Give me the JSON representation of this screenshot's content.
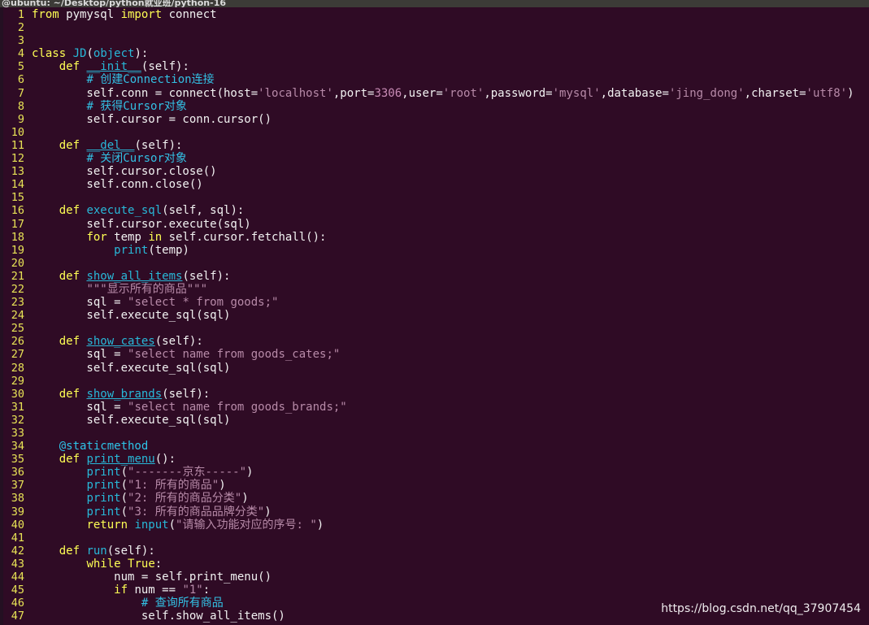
{
  "window": {
    "title": "@ubuntu: ~/Desktop/python就业班/python-16"
  },
  "editor": {
    "lines": [
      [
        [
          "k",
          "from"
        ],
        [
          "t",
          " pymysql "
        ],
        [
          "k",
          "import"
        ],
        [
          "t",
          " connect"
        ]
      ],
      [],
      [],
      [
        [
          "k",
          "class"
        ],
        [
          "t",
          " "
        ],
        [
          "b",
          "JD"
        ],
        [
          "t",
          "("
        ],
        [
          "b",
          "object"
        ],
        [
          "t",
          "):"
        ]
      ],
      [
        [
          "t",
          "    "
        ],
        [
          "k",
          "def"
        ],
        [
          "t",
          " "
        ],
        [
          "bu",
          "__init__"
        ],
        [
          "t",
          "(self):"
        ]
      ],
      [
        [
          "t",
          "        "
        ],
        [
          "c",
          "# 创建Connection连接"
        ]
      ],
      [
        [
          "t",
          "        self.conn = connect(host="
        ],
        [
          "s",
          "'localhost'"
        ],
        [
          "t",
          ",port="
        ],
        [
          "n",
          "3306"
        ],
        [
          "t",
          ",user="
        ],
        [
          "s",
          "'root'"
        ],
        [
          "t",
          ",password="
        ],
        [
          "s",
          "'mysql'"
        ],
        [
          "t",
          ",database="
        ],
        [
          "s",
          "'jing_dong'"
        ],
        [
          "t",
          ",charset="
        ],
        [
          "s",
          "'utf8'"
        ],
        [
          "t",
          ")"
        ]
      ],
      [
        [
          "t",
          "        "
        ],
        [
          "c",
          "# 获得Cursor对象"
        ]
      ],
      [
        [
          "t",
          "        self.cursor = conn.cursor()"
        ]
      ],
      [],
      [
        [
          "t",
          "    "
        ],
        [
          "k",
          "def"
        ],
        [
          "t",
          " "
        ],
        [
          "bu",
          "__del__"
        ],
        [
          "t",
          "(self):"
        ]
      ],
      [
        [
          "t",
          "        "
        ],
        [
          "c",
          "# 关闭Cursor对象"
        ]
      ],
      [
        [
          "t",
          "        self.cursor.close()"
        ]
      ],
      [
        [
          "t",
          "        self.conn.close()"
        ]
      ],
      [],
      [
        [
          "t",
          "    "
        ],
        [
          "k",
          "def"
        ],
        [
          "t",
          " "
        ],
        [
          "b",
          "execute_sql"
        ],
        [
          "t",
          "(self, sql):"
        ]
      ],
      [
        [
          "t",
          "        self.cursor.execute(sql)"
        ]
      ],
      [
        [
          "t",
          "        "
        ],
        [
          "k",
          "for"
        ],
        [
          "t",
          " temp "
        ],
        [
          "k",
          "in"
        ],
        [
          "t",
          " self.cursor.fetchall():"
        ]
      ],
      [
        [
          "t",
          "            "
        ],
        [
          "b",
          "print"
        ],
        [
          "t",
          "(temp)"
        ]
      ],
      [],
      [
        [
          "t",
          "    "
        ],
        [
          "k",
          "def"
        ],
        [
          "t",
          " "
        ],
        [
          "bu",
          "show_all_items"
        ],
        [
          "t",
          "(self):"
        ]
      ],
      [
        [
          "t",
          "        "
        ],
        [
          "s",
          "\"\"\"显示所有的商品\"\"\""
        ]
      ],
      [
        [
          "t",
          "        sql = "
        ],
        [
          "s",
          "\"select * from goods;\""
        ]
      ],
      [
        [
          "t",
          "        self.execute_sql(sql)"
        ]
      ],
      [],
      [
        [
          "t",
          "    "
        ],
        [
          "k",
          "def"
        ],
        [
          "t",
          " "
        ],
        [
          "bu",
          "show_cates"
        ],
        [
          "t",
          "(self):"
        ]
      ],
      [
        [
          "t",
          "        sql = "
        ],
        [
          "s",
          "\"select name from goods_cates;\""
        ]
      ],
      [
        [
          "t",
          "        self.execute_sql(sql)"
        ]
      ],
      [],
      [
        [
          "t",
          "    "
        ],
        [
          "k",
          "def"
        ],
        [
          "t",
          " "
        ],
        [
          "bu",
          "show_brands"
        ],
        [
          "t",
          "(self):"
        ]
      ],
      [
        [
          "t",
          "        sql = "
        ],
        [
          "s",
          "\"select name from goods_brands;\""
        ]
      ],
      [
        [
          "t",
          "        self.execute_sql(sql)"
        ]
      ],
      [],
      [
        [
          "t",
          "    "
        ],
        [
          "d",
          "@staticmethod"
        ]
      ],
      [
        [
          "t",
          "    "
        ],
        [
          "k",
          "def"
        ],
        [
          "t",
          " "
        ],
        [
          "bu",
          "print_menu"
        ],
        [
          "t",
          "():"
        ]
      ],
      [
        [
          "t",
          "        "
        ],
        [
          "b",
          "print"
        ],
        [
          "t",
          "("
        ],
        [
          "s",
          "\"-------京东-----\""
        ],
        [
          "t",
          ")"
        ]
      ],
      [
        [
          "t",
          "        "
        ],
        [
          "b",
          "print"
        ],
        [
          "t",
          "("
        ],
        [
          "s",
          "\"1: 所有的商品\""
        ],
        [
          "t",
          ")"
        ]
      ],
      [
        [
          "t",
          "        "
        ],
        [
          "b",
          "print"
        ],
        [
          "t",
          "("
        ],
        [
          "s",
          "\"2: 所有的商品分类\""
        ],
        [
          "t",
          ")"
        ]
      ],
      [
        [
          "t",
          "        "
        ],
        [
          "b",
          "print"
        ],
        [
          "t",
          "("
        ],
        [
          "s",
          "\"3: 所有的商品品牌分类\""
        ],
        [
          "t",
          ")"
        ]
      ],
      [
        [
          "t",
          "        "
        ],
        [
          "k",
          "return"
        ],
        [
          "t",
          " "
        ],
        [
          "b",
          "input"
        ],
        [
          "t",
          "("
        ],
        [
          "s",
          "\"请输入功能对应的序号: \""
        ],
        [
          "t",
          ")"
        ]
      ],
      [],
      [
        [
          "t",
          "    "
        ],
        [
          "k",
          "def"
        ],
        [
          "t",
          " "
        ],
        [
          "b",
          "run"
        ],
        [
          "t",
          "(self):"
        ]
      ],
      [
        [
          "t",
          "        "
        ],
        [
          "k",
          "while"
        ],
        [
          "t",
          " "
        ],
        [
          "k",
          "True"
        ],
        [
          "t",
          ":"
        ]
      ],
      [
        [
          "t",
          "            num = self.print_menu()"
        ]
      ],
      [
        [
          "t",
          "            "
        ],
        [
          "k",
          "if"
        ],
        [
          "t",
          " num == "
        ],
        [
          "s",
          "\"1\""
        ],
        [
          "t",
          ":"
        ]
      ],
      [
        [
          "t",
          "                "
        ],
        [
          "c",
          "# 查询所有商品"
        ]
      ],
      [
        [
          "t",
          "                self.show_all_items()"
        ]
      ]
    ]
  },
  "watermark": {
    "text": "https://blog.csdn.net/qq_37907454"
  }
}
